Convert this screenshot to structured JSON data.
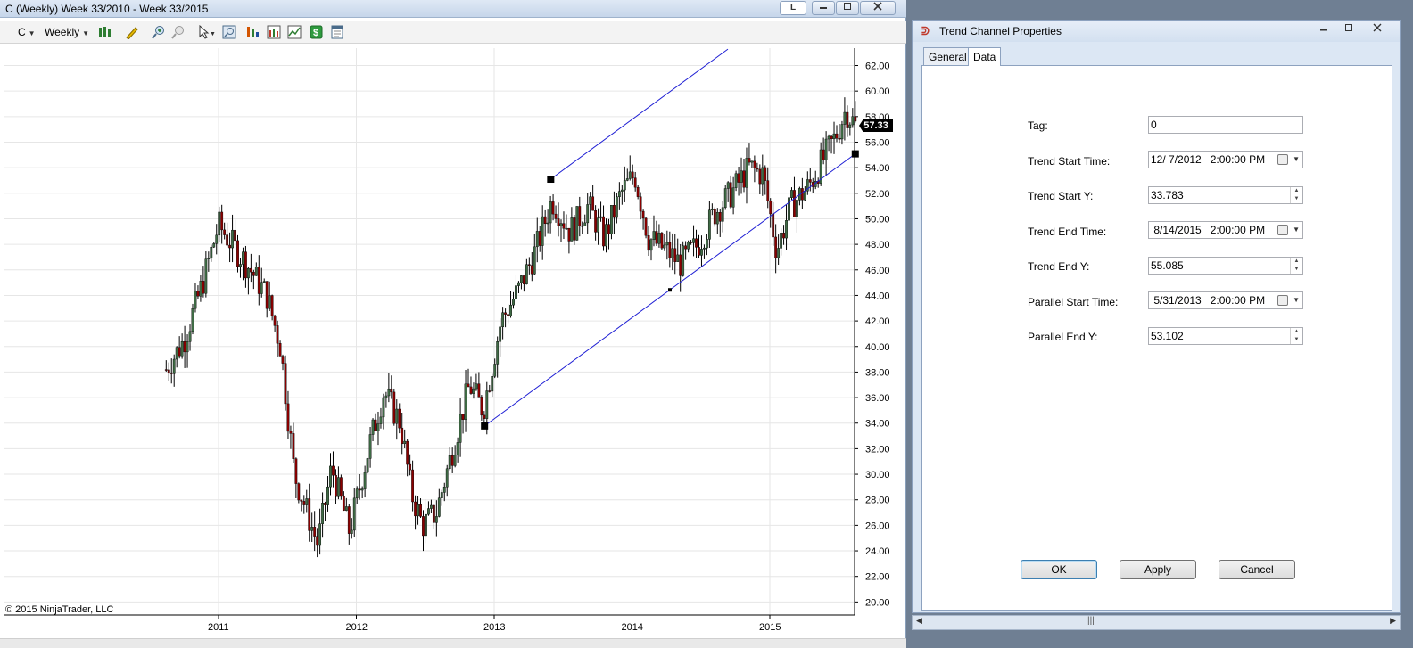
{
  "chart_window": {
    "title": "C (Weekly)  Week 33/2010 - Week 33/2015",
    "badge": "L",
    "toolbar": {
      "instrument": "C",
      "interval": "Weekly",
      "icons": [
        "bar-type-icon",
        "pencil-draw-icon",
        "zoom-in-icon",
        "zoom-out-icon",
        "cursor-icon",
        "magnifier-icon",
        "indicators-icon",
        "strategies-icon",
        "chart-properties-icon",
        "dollar-icon",
        "data-box-icon"
      ]
    },
    "copyright": "© 2015 NinjaTrader, LLC",
    "price_flag": "57.33"
  },
  "chart_data": {
    "type": "candlestick",
    "instrument": "C",
    "interval": "Weekly",
    "x_tick_labels": [
      "2011",
      "2012",
      "2013",
      "2014",
      "2015"
    ],
    "y_tick_labels": [
      "62.00",
      "60.00",
      "58.00",
      "56.00",
      "54.00",
      "52.00",
      "50.00",
      "48.00",
      "46.00",
      "44.00",
      "42.00",
      "40.00",
      "38.00",
      "36.00",
      "34.00",
      "32.00",
      "30.00",
      "28.00",
      "26.00",
      "24.00",
      "22.00",
      "20.00"
    ],
    "ylim": [
      19,
      63
    ],
    "grid": true,
    "last_price": 57.33,
    "up_color": "#3f6b45",
    "down_color": "#8b0000",
    "series_trend": [
      {
        "x": 2010.62,
        "y": 38.2
      },
      {
        "x": 2010.75,
        "y": 40.5
      },
      {
        "x": 2010.88,
        "y": 44.8
      },
      {
        "x": 2011.0,
        "y": 49.5
      },
      {
        "x": 2011.1,
        "y": 48.0
      },
      {
        "x": 2011.22,
        "y": 46.2
      },
      {
        "x": 2011.35,
        "y": 44.0
      },
      {
        "x": 2011.45,
        "y": 40.0
      },
      {
        "x": 2011.55,
        "y": 30.0
      },
      {
        "x": 2011.72,
        "y": 24.5
      },
      {
        "x": 2011.82,
        "y": 30.5
      },
      {
        "x": 2011.95,
        "y": 25.5
      },
      {
        "x": 2012.1,
        "y": 32.5
      },
      {
        "x": 2012.2,
        "y": 36.5
      },
      {
        "x": 2012.32,
        "y": 34.0
      },
      {
        "x": 2012.4,
        "y": 28.5
      },
      {
        "x": 2012.48,
        "y": 26.0
      },
      {
        "x": 2012.58,
        "y": 27.0
      },
      {
        "x": 2012.7,
        "y": 32.0
      },
      {
        "x": 2012.82,
        "y": 37.0
      },
      {
        "x": 2012.92,
        "y": 35.0
      },
      {
        "x": 2013.05,
        "y": 42.0
      },
      {
        "x": 2013.18,
        "y": 44.5
      },
      {
        "x": 2013.3,
        "y": 47.5
      },
      {
        "x": 2013.42,
        "y": 51.5
      },
      {
        "x": 2013.55,
        "y": 49.0
      },
      {
        "x": 2013.68,
        "y": 51.0
      },
      {
        "x": 2013.8,
        "y": 48.5
      },
      {
        "x": 2013.92,
        "y": 52.0
      },
      {
        "x": 2014.02,
        "y": 53.5
      },
      {
        "x": 2014.12,
        "y": 48.5
      },
      {
        "x": 2014.25,
        "y": 47.5
      },
      {
        "x": 2014.35,
        "y": 46.5
      },
      {
        "x": 2014.48,
        "y": 48.0
      },
      {
        "x": 2014.6,
        "y": 50.5
      },
      {
        "x": 2014.72,
        "y": 52.0
      },
      {
        "x": 2014.85,
        "y": 54.0
      },
      {
        "x": 2014.95,
        "y": 53.5
      },
      {
        "x": 2015.05,
        "y": 47.5
      },
      {
        "x": 2015.15,
        "y": 51.0
      },
      {
        "x": 2015.28,
        "y": 52.5
      },
      {
        "x": 2015.38,
        "y": 54.5
      },
      {
        "x": 2015.48,
        "y": 56.5
      },
      {
        "x": 2015.55,
        "y": 58.5
      },
      {
        "x": 2015.62,
        "y": 57.3
      }
    ],
    "trend_channel": {
      "trend_start": {
        "x": 2012.93,
        "y": 33.783
      },
      "trend_end": {
        "x": 2015.62,
        "y": 55.085
      },
      "parallel_start": {
        "x": 2013.41,
        "y": 53.102
      },
      "line_color": "#1f1fd4"
    }
  },
  "dialog": {
    "title": "Trend Channel Properties",
    "tabs": [
      "General",
      "Data"
    ],
    "active_tab": "Data",
    "fields": {
      "tag": {
        "label": "Tag:",
        "value": "0"
      },
      "trend_start_time": {
        "label": "Trend Start Time:",
        "value": "12/ 7/2012   2:00:00 PM"
      },
      "trend_start_y": {
        "label": "Trend Start Y:",
        "value": "33.783"
      },
      "trend_end_time": {
        "label": "Trend End Time:",
        "value": " 8/14/2015   2:00:00 PM"
      },
      "trend_end_y": {
        "label": "Trend End Y:",
        "value": "55.085"
      },
      "parallel_start_time": {
        "label": "Parallel Start Time:",
        "value": " 5/31/2013   2:00:00 PM"
      },
      "parallel_end_y": {
        "label": "Parallel End Y:",
        "value": "53.102"
      }
    },
    "buttons": {
      "ok": "OK",
      "apply": "Apply",
      "cancel": "Cancel"
    }
  }
}
